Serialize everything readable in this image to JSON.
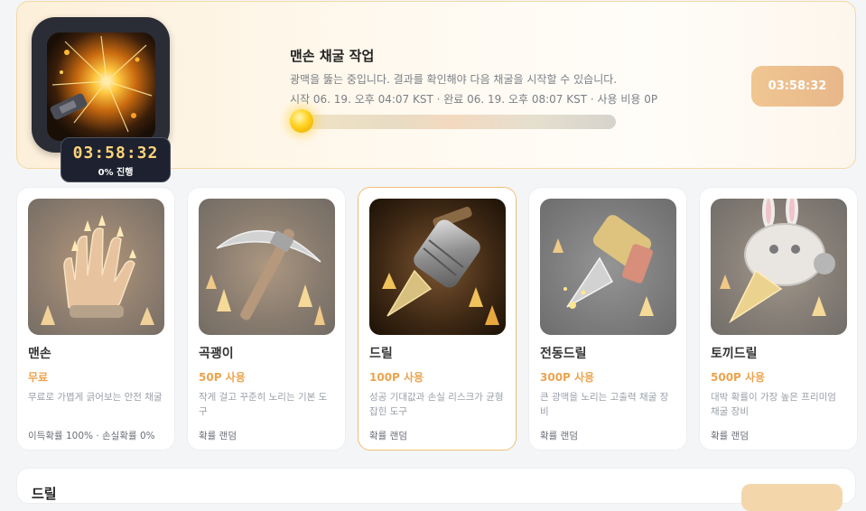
{
  "job": {
    "title": "맨손 채굴 작업",
    "description": "광맥을 뚫는 중입니다. 결과를 확인해야 다음 채굴을 시작할 수 있습니다.",
    "meta": "시작 06. 19. 오후 04:07 KST · 완료 06. 19. 오후 08:07 KST · 사용 비용 0P",
    "timer": "03:58:32",
    "progress_label": "0% 진행",
    "progress_fraction": 0.0,
    "button_label": "03:58:32"
  },
  "tools": [
    {
      "name": "맨손",
      "price": "무료",
      "description": "무료로 가볍게 긁어보는 안전 채굴",
      "footer": "이득확률 100% · 손실확률 0%",
      "icon": "glove-icon"
    },
    {
      "name": "곡괭이",
      "price": "50P 사용",
      "description": "작게 걸고 꾸준히 노리는 기본 도구",
      "footer": "확률 랜덤",
      "icon": "pickaxe-icon"
    },
    {
      "name": "드릴",
      "price": "100P 사용",
      "description": "성공 기대값과 손실 리스크가 균형 잡힌 도구",
      "footer": "확률 랜덤",
      "icon": "drill-icon"
    },
    {
      "name": "전동드릴",
      "price": "300P 사용",
      "description": "큰 광맥을 노리는 고출력 채굴 장비",
      "footer": "확률 랜덤",
      "icon": "power-drill-icon"
    },
    {
      "name": "토끼드릴",
      "price": "500P 사용",
      "description": "대박 확률이 가장 높은 프리미엄 채굴 장비",
      "footer": "확률 랜덤",
      "icon": "rabbit-drill-icon"
    }
  ],
  "selected_tool": "드릴",
  "bottom_section": {
    "title": "드릴"
  },
  "colors": {
    "accent": "#eba44f",
    "selected_border": "#f0c078",
    "timer": "#ffd47a"
  }
}
